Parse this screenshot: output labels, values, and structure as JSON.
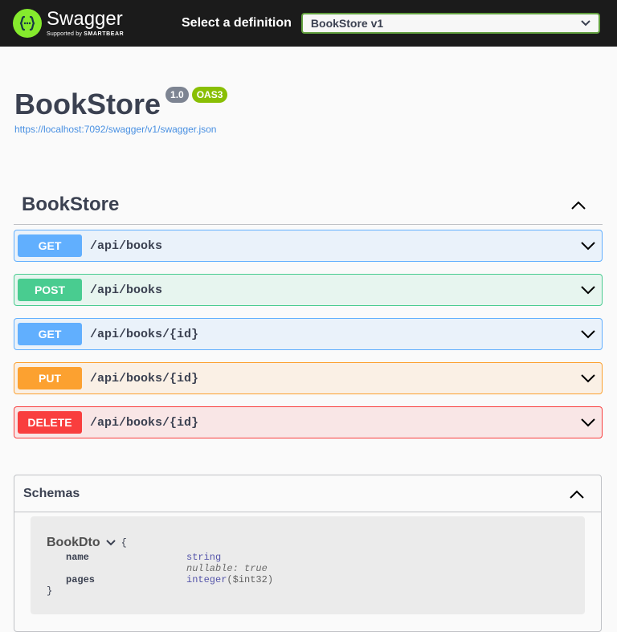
{
  "topbar": {
    "brand": "Swagger",
    "supported_by": "Supported by",
    "smartbear": "SMARTBEAR",
    "select_label": "Select a definition",
    "selected_definition": "BookStore v1"
  },
  "info": {
    "title": "BookStore",
    "version_badge": "1.0",
    "oas_badge": "OAS3",
    "spec_url": "https://localhost:7092/swagger/v1/swagger.json"
  },
  "tag": {
    "name": "BookStore",
    "operations": [
      {
        "method": "GET",
        "path": "/api/books"
      },
      {
        "method": "POST",
        "path": "/api/books"
      },
      {
        "method": "GET",
        "path": "/api/books/{id}"
      },
      {
        "method": "PUT",
        "path": "/api/books/{id}"
      },
      {
        "method": "DELETE",
        "path": "/api/books/{id}"
      }
    ]
  },
  "schemas": {
    "title": "Schemas",
    "model": {
      "name": "BookDto",
      "open_brace": "{",
      "close_brace": "}",
      "props": [
        {
          "name": "name",
          "type": "string",
          "format": "",
          "extra": "nullable: true"
        },
        {
          "name": "pages",
          "type": "integer",
          "format": "($int32)",
          "extra": ""
        }
      ]
    }
  },
  "colors": {
    "get": "#61affe",
    "post": "#49cc90",
    "put": "#fca130",
    "delete": "#f93e3e",
    "brand_green": "#85ea2d"
  }
}
